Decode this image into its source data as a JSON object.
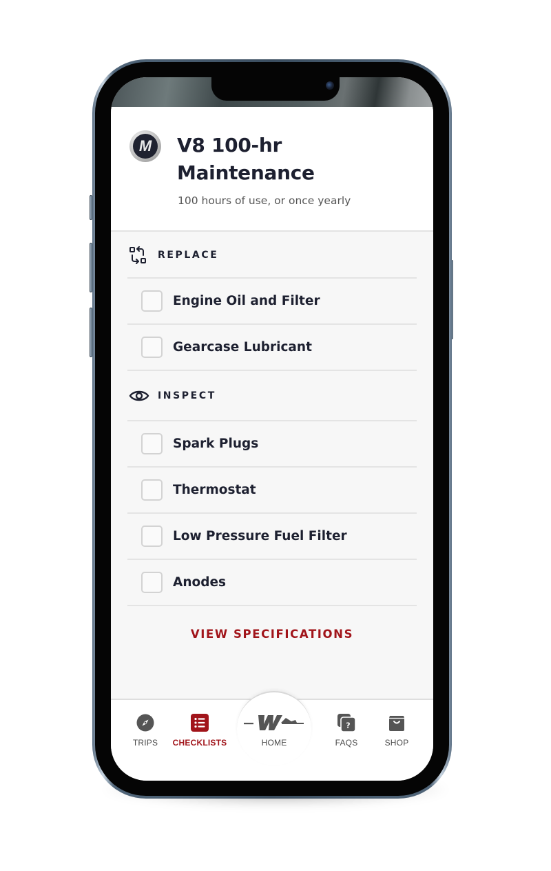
{
  "header": {
    "title_line1": "V8 100-hr",
    "title_line2": "Maintenance",
    "subtitle": "100 hours of use, or once yearly",
    "logo_letter": "M"
  },
  "sections": [
    {
      "label": "REPLACE",
      "icon": "replace-icon",
      "items": [
        {
          "label": "Engine Oil and Filter",
          "checked": false
        },
        {
          "label": "Gearcase Lubricant",
          "checked": false
        }
      ]
    },
    {
      "label": "INSPECT",
      "icon": "eye-icon",
      "items": [
        {
          "label": "Spark Plugs",
          "checked": false
        },
        {
          "label": "Thermostat",
          "checked": false
        },
        {
          "label": "Low Pressure Fuel Filter",
          "checked": false
        },
        {
          "label": "Anodes",
          "checked": false
        }
      ]
    }
  ],
  "view_specs_label": "VIEW SPECIFICATIONS",
  "nav": {
    "items": [
      {
        "label": "TRIPS",
        "icon": "compass-icon",
        "active": false
      },
      {
        "label": "CHECKLISTS",
        "icon": "checklist-icon",
        "active": true
      },
      {
        "label": "HOME",
        "icon": "home-logo-icon",
        "active": false
      },
      {
        "label": "FAQS",
        "icon": "faq-icon",
        "active": false
      },
      {
        "label": "SHOP",
        "icon": "shopping-bag-icon",
        "active": false
      }
    ]
  },
  "colors": {
    "accent": "#a1141a",
    "text_dark": "#1d2030",
    "icon_gray": "#555555"
  }
}
